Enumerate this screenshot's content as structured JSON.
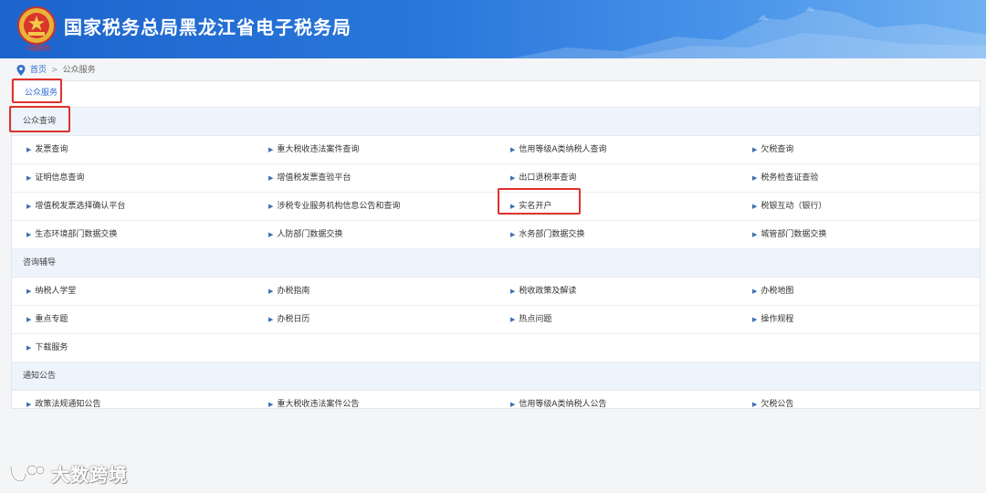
{
  "header": {
    "emblem_caption": "中国税务",
    "site_title": "国家税务总局黑龙江省电子税务局"
  },
  "breadcrumb": {
    "home": "首页",
    "separator": ">",
    "current": "公众服务"
  },
  "tab": {
    "label": "公众服务"
  },
  "sections": [
    {
      "title": "公众查询",
      "rows": [
        [
          "发票查询",
          "重大税收违法案件查询",
          "信用等级A类纳税人查询",
          "欠税查询"
        ],
        [
          "证明信息查询",
          "增值税发票查验平台",
          "出口退税率查询",
          "税务检查证查验"
        ],
        [
          "增值税发票选择确认平台",
          "涉税专业服务机构信息公告和查询",
          "实名开户",
          "税银互动（银行）"
        ],
        [
          "生态环境部门数据交换",
          "人防部门数据交换",
          "水务部门数据交换",
          "城管部门数据交换"
        ]
      ]
    },
    {
      "title": "咨询辅导",
      "rows": [
        [
          "纳税人学堂",
          "办税指南",
          "税收政策及解读",
          "办税地图"
        ],
        [
          "重点专题",
          "办税日历",
          "热点问题",
          "操作规程"
        ],
        [
          "下载服务",
          "",
          "",
          ""
        ]
      ]
    },
    {
      "title": "通知公告",
      "rows": [
        [
          "政策法规通知公告",
          "重大税收违法案件公告",
          "信用等级A类纳税人公告",
          "欠税公告"
        ]
      ]
    }
  ],
  "watermark": {
    "text": "大数跨境"
  },
  "colors": {
    "header_blue": "#1c64cc",
    "link_blue": "#2d6fd1",
    "section_bg": "#eef4fb",
    "highlight_red": "#e0312b"
  },
  "icons": {
    "location": "pin-icon",
    "bullet": "triangle-right-icon",
    "emblem": "tax-emblem-icon",
    "watermark_logo": "dashu-logo-icon"
  }
}
